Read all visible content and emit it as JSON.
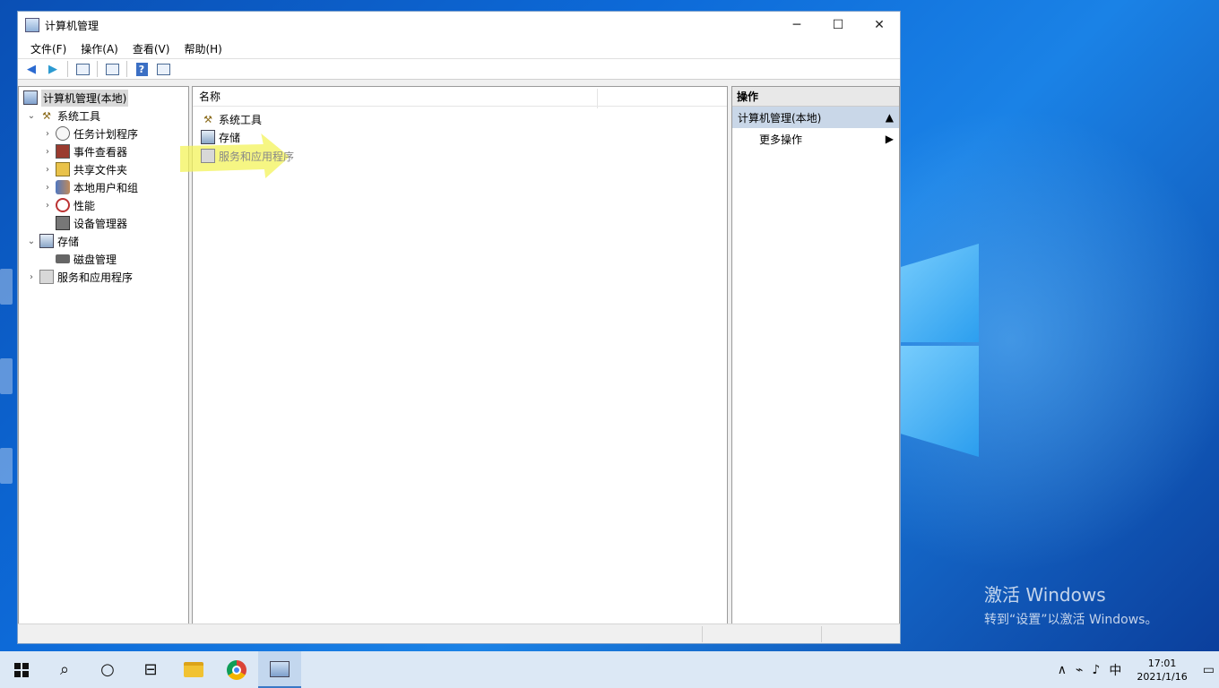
{
  "window": {
    "title": "计算机管理",
    "controls": {
      "minimize": "─",
      "maximize": "☐",
      "close": "✕"
    }
  },
  "menu": [
    "文件(F)",
    "操作(A)",
    "查看(V)",
    "帮助(H)"
  ],
  "tree": {
    "root": "计算机管理(本地)",
    "system_tools": "系统工具",
    "task_scheduler": "任务计划程序",
    "event_viewer": "事件查看器",
    "shared_folders": "共享文件夹",
    "local_users": "本地用户和组",
    "performance": "性能",
    "device_manager": "设备管理器",
    "storage": "存储",
    "disk_management": "磁盘管理",
    "services_apps": "服务和应用程序"
  },
  "list": {
    "column_name": "名称",
    "items": [
      "系统工具",
      "存储",
      "服务和应用程序"
    ]
  },
  "actions": {
    "header": "操作",
    "group": "计算机管理(本地)",
    "more": "更多操作"
  },
  "desktop": {
    "activate_title": "激活 Windows",
    "activate_sub": "转到“设置”以激活 Windows。"
  },
  "taskbar": {
    "ime": "中",
    "time": "17:01",
    "date": "2021/1/16"
  }
}
